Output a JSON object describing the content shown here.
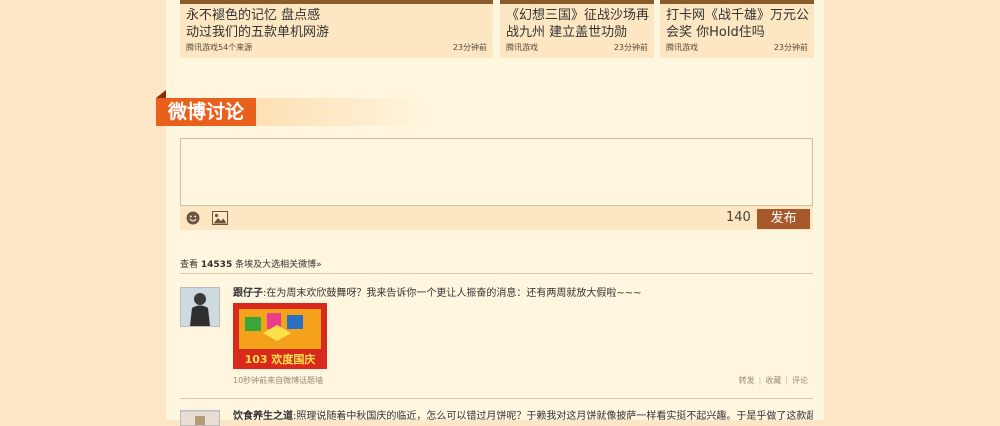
{
  "articles": [
    {
      "title": "永不褪色的记忆 盘点感动过我们的五款单机网游",
      "source": "腾讯游戏54个来源",
      "time": "23分钟前"
    },
    {
      "title": "《幻想三国》征战沙场再战九州 建立盖世功勋",
      "source": "腾讯游戏",
      "time": "23分钟前"
    },
    {
      "title": "打卡网《战千雄》万元公会奖 你Hold住吗",
      "source": "腾讯游戏",
      "time": "23分钟前"
    }
  ],
  "weibo": {
    "section_title": "微博讨论",
    "composer": {
      "placeholder": "",
      "char_count": "140",
      "post_label": "发布"
    },
    "summary": {
      "prefix": "查看",
      "count": "14535",
      "suffix": "条埃及大选相关微博»"
    },
    "posts": [
      {
        "author": "跟仔子",
        "text": "在为周末欢欣鼓舞呀？我来告诉你一个更让人振奋的消息：还有两周就放大假啦~~~",
        "image_text": "103 欢度国庆",
        "meta": "10秒钟前来自微博话题墙",
        "actions": [
          "转发",
          "收藏",
          "评论"
        ]
      },
      {
        "author": "饮食养生之道",
        "text": "照理说随着中秋国庆的临近，怎么可以错过月饼呢？于赖我对这月饼就像披萨一样看实挺不起兴趣。于是乎做了这款超高热量"
      }
    ]
  },
  "colors": {
    "accent": "#e9601d",
    "post_button": "#a65a2b",
    "page_bg": "#fde7c6",
    "content_bg": "#fff6df"
  }
}
